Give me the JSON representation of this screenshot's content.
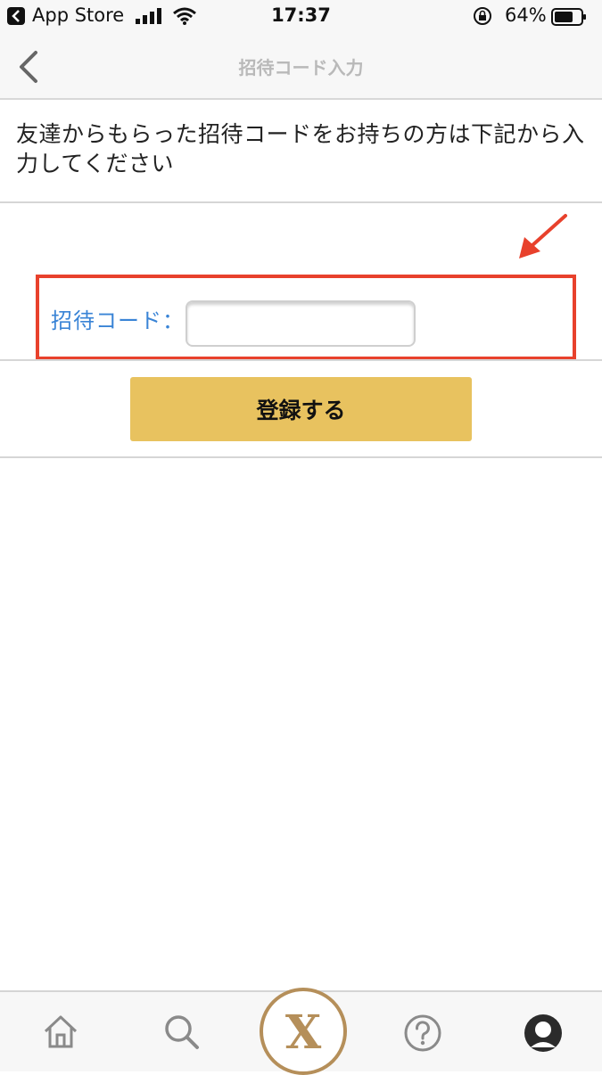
{
  "status_bar": {
    "back_app": "App Store",
    "time": "17:37",
    "battery": "64%"
  },
  "nav": {
    "title": "招待コード入力",
    "back_icon": "chevron-left-icon"
  },
  "description": "友達からもらった招待コードをお持ちの方は下記から入力してください",
  "form": {
    "code_label": "招待コード：",
    "code_value": "",
    "submit_label": "登録する"
  },
  "colors": {
    "accent_gold": "#e8c25f",
    "label_blue": "#3a84d6",
    "annotation_red": "#e8412c",
    "brand_bronze": "#b58f5a"
  },
  "tab_bar": {
    "items": [
      {
        "icon": "home-icon"
      },
      {
        "icon": "search-icon"
      },
      {
        "icon": "brand-x-icon",
        "glyph": "X"
      },
      {
        "icon": "help-icon"
      },
      {
        "icon": "profile-icon"
      }
    ]
  }
}
